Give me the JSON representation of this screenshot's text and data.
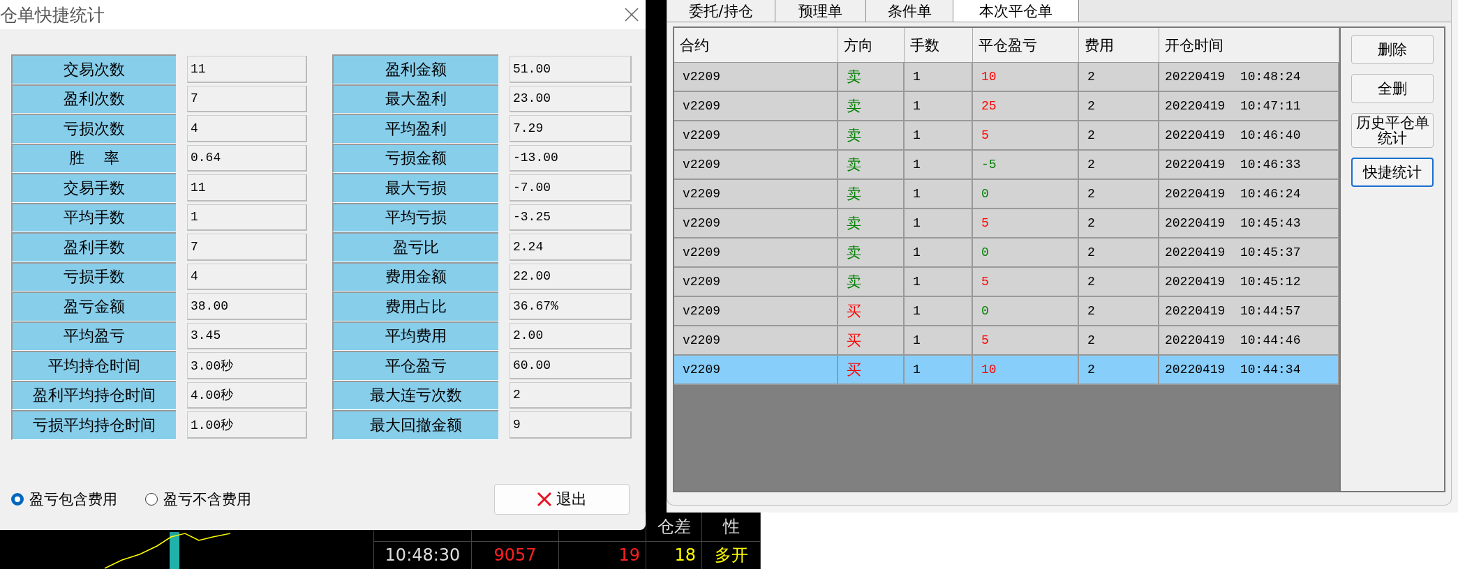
{
  "dialog": {
    "title": "仓单快捷统计",
    "left_stats": [
      {
        "label": "交易次数",
        "value": "11"
      },
      {
        "label": "盈利次数",
        "value": "7"
      },
      {
        "label": "亏损次数",
        "value": "4"
      },
      {
        "label": "胜    率",
        "value": "0.64"
      },
      {
        "label": "交易手数",
        "value": "11"
      },
      {
        "label": "平均手数",
        "value": "1"
      },
      {
        "label": "盈利手数",
        "value": "7"
      },
      {
        "label": "亏损手数",
        "value": "4"
      },
      {
        "label": "盈亏金额",
        "value": "38.00"
      },
      {
        "label": "平均盈亏",
        "value": "3.45"
      },
      {
        "label": "平均持仓时间",
        "value": "3.00秒"
      },
      {
        "label": "盈利平均持仓时间",
        "value": "4.00秒"
      },
      {
        "label": "亏损平均持仓时间",
        "value": "1.00秒"
      }
    ],
    "right_stats": [
      {
        "label": "盈利金额",
        "value": "51.00"
      },
      {
        "label": "最大盈利",
        "value": "23.00"
      },
      {
        "label": "平均盈利",
        "value": "7.29"
      },
      {
        "label": "亏损金额",
        "value": "-13.00"
      },
      {
        "label": "最大亏损",
        "value": "-7.00"
      },
      {
        "label": "平均亏损",
        "value": "-3.25"
      },
      {
        "label": "盈亏比",
        "value": "2.24"
      },
      {
        "label": "费用金额",
        "value": "22.00"
      },
      {
        "label": "费用占比",
        "value": "36.67%"
      },
      {
        "label": "平均费用",
        "value": "2.00"
      },
      {
        "label": "平仓盈亏",
        "value": "60.00"
      },
      {
        "label": "最大连亏次数",
        "value": "2"
      },
      {
        "label": "最大回撤金额",
        "value": "9"
      }
    ],
    "radios": [
      {
        "label": "盈亏包含费用",
        "selected": true
      },
      {
        "label": "盈亏不含费用",
        "selected": false
      }
    ],
    "exit_button": "退出"
  },
  "panel": {
    "tabs": [
      {
        "label": "委托/持仓",
        "selected": false
      },
      {
        "label": "预理单",
        "selected": false
      },
      {
        "label": "条件单",
        "selected": false
      },
      {
        "label": "本次平仓单",
        "selected": true
      }
    ],
    "table": {
      "columns": [
        "合约",
        "方向",
        "手数",
        "平仓盈亏",
        "费用",
        "开仓时间"
      ],
      "rows": [
        {
          "contract": "v2209",
          "direction": {
            "text": "卖",
            "color": "#008000"
          },
          "qty": "1",
          "pnl": {
            "text": "10",
            "color": "#ff0000"
          },
          "fee": "2",
          "time": "20220419  10:48:24",
          "selected": false
        },
        {
          "contract": "v2209",
          "direction": {
            "text": "卖",
            "color": "#008000"
          },
          "qty": "1",
          "pnl": {
            "text": "25",
            "color": "#ff0000"
          },
          "fee": "2",
          "time": "20220419  10:47:11",
          "selected": false
        },
        {
          "contract": "v2209",
          "direction": {
            "text": "卖",
            "color": "#008000"
          },
          "qty": "1",
          "pnl": {
            "text": "5",
            "color": "#ff0000"
          },
          "fee": "2",
          "time": "20220419  10:46:40",
          "selected": false
        },
        {
          "contract": "v2209",
          "direction": {
            "text": "卖",
            "color": "#008000"
          },
          "qty": "1",
          "pnl": {
            "text": "-5",
            "color": "#008000"
          },
          "fee": "2",
          "time": "20220419  10:46:33",
          "selected": false
        },
        {
          "contract": "v2209",
          "direction": {
            "text": "卖",
            "color": "#008000"
          },
          "qty": "1",
          "pnl": {
            "text": "0",
            "color": "#008000"
          },
          "fee": "2",
          "time": "20220419  10:46:24",
          "selected": false
        },
        {
          "contract": "v2209",
          "direction": {
            "text": "卖",
            "color": "#008000"
          },
          "qty": "1",
          "pnl": {
            "text": "5",
            "color": "#ff0000"
          },
          "fee": "2",
          "time": "20220419  10:45:43",
          "selected": false
        },
        {
          "contract": "v2209",
          "direction": {
            "text": "卖",
            "color": "#008000"
          },
          "qty": "1",
          "pnl": {
            "text": "0",
            "color": "#008000"
          },
          "fee": "2",
          "time": "20220419  10:45:37",
          "selected": false
        },
        {
          "contract": "v2209",
          "direction": {
            "text": "卖",
            "color": "#008000"
          },
          "qty": "1",
          "pnl": {
            "text": "5",
            "color": "#ff0000"
          },
          "fee": "2",
          "time": "20220419  10:45:12",
          "selected": false
        },
        {
          "contract": "v2209",
          "direction": {
            "text": "买",
            "color": "#ff0000"
          },
          "qty": "1",
          "pnl": {
            "text": "0",
            "color": "#008000"
          },
          "fee": "2",
          "time": "20220419  10:44:57",
          "selected": false
        },
        {
          "contract": "v2209",
          "direction": {
            "text": "买",
            "color": "#ff0000"
          },
          "qty": "1",
          "pnl": {
            "text": "5",
            "color": "#ff0000"
          },
          "fee": "2",
          "time": "20220419  10:44:46",
          "selected": false
        },
        {
          "contract": "v2209",
          "direction": {
            "text": "买",
            "color": "#ff0000"
          },
          "qty": "1",
          "pnl": {
            "text": "10",
            "color": "#ff0000"
          },
          "fee": "2",
          "time": "20220419  10:44:34",
          "selected": true
        }
      ]
    },
    "buttons": [
      {
        "label": "删除",
        "focused": false
      },
      {
        "label": "全删",
        "focused": false
      },
      {
        "label": "历史平仓单统计",
        "focused": false
      },
      {
        "label": "快捷统计",
        "focused": true
      }
    ]
  },
  "tick_table": {
    "columns": [
      "仓差",
      "性"
    ],
    "rows": [
      {
        "time": "10:48:30",
        "price": "9057",
        "volume": "19",
        "oi_change": "18",
        "nature": "多开"
      }
    ]
  }
}
